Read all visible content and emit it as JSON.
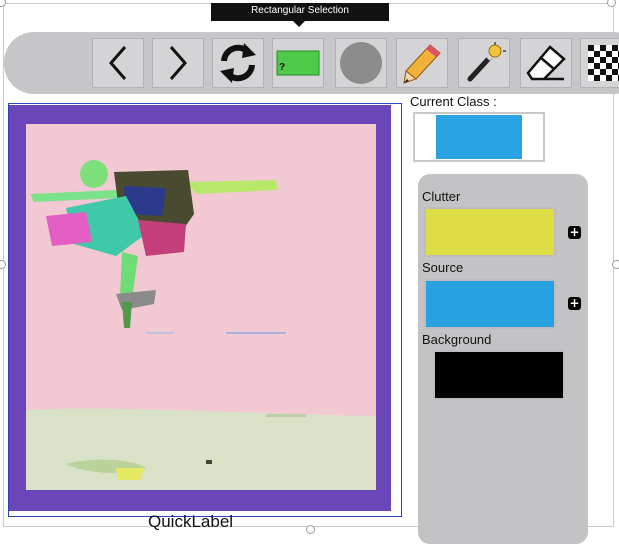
{
  "tooltip": {
    "text": "Rectangular Selection"
  },
  "toolbar": {
    "tools": [
      {
        "name": "previous",
        "icon": "chevron-left-icon"
      },
      {
        "name": "next",
        "icon": "chevron-right-icon"
      },
      {
        "name": "refresh",
        "icon": "refresh-icon"
      },
      {
        "name": "rectangular-selection",
        "icon": "rectangle-selection-icon",
        "badge": "?"
      },
      {
        "name": "circle-selection",
        "icon": "circle-icon"
      },
      {
        "name": "pencil",
        "icon": "pencil-icon"
      },
      {
        "name": "magic-wand",
        "icon": "magic-wand-icon"
      },
      {
        "name": "eraser",
        "icon": "eraser-icon"
      },
      {
        "name": "checkerboard",
        "icon": "checkerboard-icon"
      }
    ]
  },
  "current_class": {
    "label": "Current Class :",
    "color": "#29a3e2"
  },
  "classes": [
    {
      "label": "Clutter",
      "color": "#dedd45"
    },
    {
      "label": "Source",
      "color": "#29a0e0"
    },
    {
      "label": "Background",
      "color": "#000000"
    }
  ],
  "plus_symbol": "+",
  "footer": {
    "title": "QuickLabel"
  }
}
